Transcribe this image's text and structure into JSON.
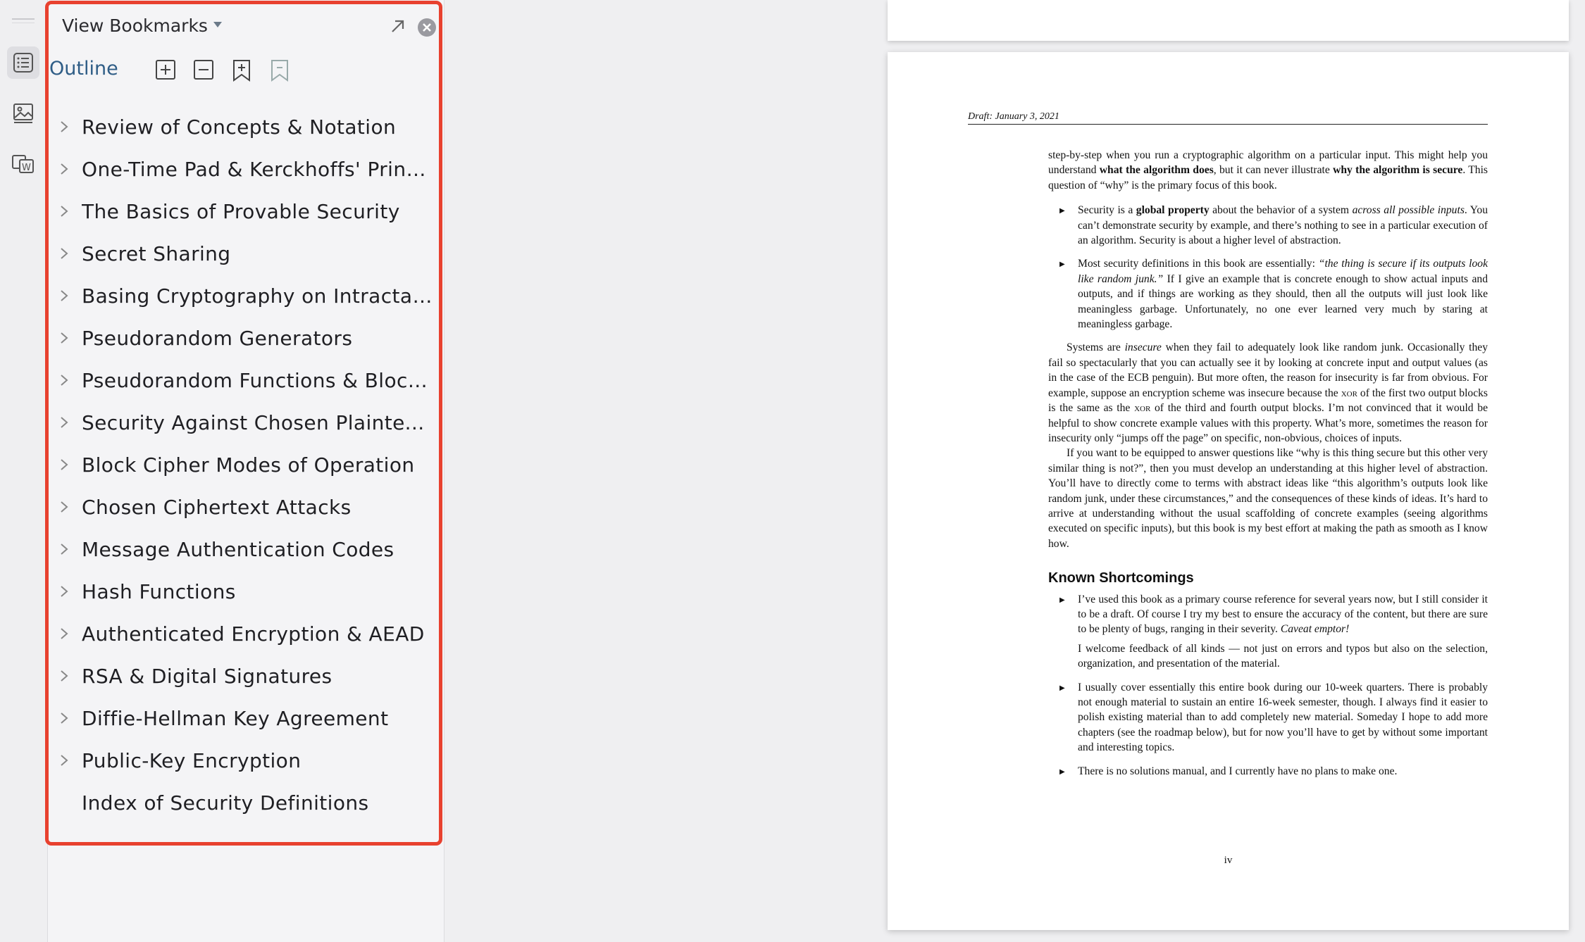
{
  "sidebar": {
    "title": "View Bookmarks",
    "outline_label": "Outline",
    "icons": {
      "expand_all": "plus-square-icon",
      "collapse_all": "minus-square-icon",
      "add_bookmark": "bookmark-add-icon",
      "remove_bookmark": "bookmark-remove-icon"
    },
    "bookmarks": [
      {
        "label": "Review of Concepts & Notation",
        "expandable": true
      },
      {
        "label": "One-Time Pad & Kerckhoffs' Principle",
        "expandable": true
      },
      {
        "label": "The Basics of Provable Security",
        "expandable": true
      },
      {
        "label": "Secret Sharing",
        "expandable": true
      },
      {
        "label": "Basing Cryptography on Intractable C...",
        "expandable": true
      },
      {
        "label": "Pseudorandom Generators",
        "expandable": true
      },
      {
        "label": "Pseudorandom Functions & Block Cip...",
        "expandable": true
      },
      {
        "label": "Security Against Chosen Plaintext Att...",
        "expandable": true
      },
      {
        "label": "Block Cipher Modes of Operation",
        "expandable": true
      },
      {
        "label": "Chosen Ciphertext Attacks",
        "expandable": true
      },
      {
        "label": "Message Authentication Codes",
        "expandable": true
      },
      {
        "label": "Hash Functions",
        "expandable": true
      },
      {
        "label": "Authenticated Encryption & AEAD",
        "expandable": true
      },
      {
        "label": "RSA & Digital Signatures",
        "expandable": true
      },
      {
        "label": "Diffie-Hellman Key Agreement",
        "expandable": true
      },
      {
        "label": "Public-Key Encryption",
        "expandable": true
      },
      {
        "label": "Index of Security Definitions",
        "expandable": false
      }
    ]
  },
  "colors": {
    "highlight_frame": "#e8412f",
    "outline_label": "#2f5d86"
  },
  "document": {
    "running_head": "Draft: January 3, 2021",
    "page_number": "iv",
    "intro_a": "step-by-step when you run a cryptographic algorithm on a particular input. This might help you understand ",
    "intro_b": "what the algorithm does",
    "intro_c": ", but it can never illustrate ",
    "intro_d": "why the algorithm is secure",
    "intro_e": ". This question of “why” is the primary focus of this book.",
    "b1_a": "Security is a ",
    "b1_b": "global property",
    "b1_c": " about the behavior of a system ",
    "b1_d": "across all possible inputs",
    "b1_e": ". You can’t demonstrate security by example, and there’s nothing to see in a particular execution of an algorithm. Security is about a higher level of abstraction.",
    "b2_a": "Most security definitions in this book are essentially: ",
    "b2_b": "“the thing is secure if its outputs look like random junk.”",
    "b2_c": " If I give an example that is concrete enough to show actual inputs and outputs, and if things are working as they should, then all the outputs will just look like meaningless garbage. Unfortunately, no one ever learned very much by staring at meaningless garbage.",
    "p1_a": "Systems are ",
    "p1_b": "insecure",
    "p1_c": " when they fail to adequately look like random junk. Occasionally they fail so spectacularly that you can actually see it by looking at concrete input and output values (as in the case of the ECB penguin). But more often, the reason for insecurity is far from obvious. For example, suppose an encryption scheme was insecure because the ",
    "p1_xor1": "xor",
    "p1_d": " of the first two output blocks is the same as the ",
    "p1_xor2": "xor",
    "p1_e": " of the third and fourth output blocks. I’m not convinced that it would be helpful to show concrete example values with this property. What’s more, sometimes the reason for insecurity only “jumps off the page” on specific, non-obvious, choices of inputs.",
    "p2": "If you want to be equipped to answer questions like “why is this thing secure but this other very similar thing is not?”, then you must develop an understanding at this higher level of abstraction. You’ll have to directly come to terms with abstract ideas like “this algorithm’s outputs look like random junk, under these circumstances,” and the consequences of these kinds of ideas. It’s hard to arrive at understanding without the usual scaffolding of concrete examples (seeing algorithms executed on specific inputs), but this book is my best effort at making the path as smooth as I know how.",
    "section_heading": "Known Shortcomings",
    "s1_a": "I’ve used this book as a primary course reference for several years now, but I still consider it to be a draft. Of course I try my best to ensure the accuracy of the content, but there are sure to be plenty of bugs, ranging in their severity. ",
    "s1_b": "Caveat emptor!",
    "s1_p2": "I welcome feedback of all kinds — not just on errors and typos but also on the selection, organization, and presentation of the material.",
    "s2": "I usually cover essentially this entire book during our 10-week quarters. There is probably not enough material to sustain an entire 16-week semester, though. I always find it easier to polish existing material than to add completely new material. Someday I hope to add more chapters (see the roadmap below), but for now you’ll have to get by without some important and interesting topics.",
    "s3": "There is no solutions manual, and I currently have no plans to make one."
  }
}
